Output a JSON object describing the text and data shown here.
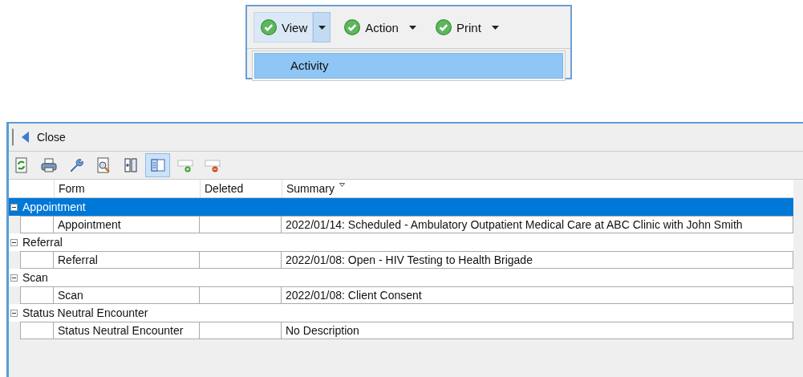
{
  "menu_bar": {
    "buttons": [
      {
        "label": "View",
        "selected": true
      },
      {
        "label": "Action",
        "selected": false
      },
      {
        "label": "Print",
        "selected": false
      }
    ],
    "dropdown": [
      {
        "label": "Activity",
        "selected": true
      }
    ]
  },
  "window": {
    "close_label": "Close",
    "toolbar": [
      {
        "kind": "refresh",
        "pressed": false
      },
      {
        "kind": "print",
        "pressed": false
      },
      {
        "kind": "wrench",
        "pressed": false
      },
      {
        "kind": "preview",
        "pressed": false
      },
      {
        "kind": "columns",
        "pressed": false
      },
      {
        "kind": "layout",
        "pressed": true
      },
      {
        "kind": "add",
        "pressed": false
      },
      {
        "kind": "remove",
        "pressed": false
      }
    ],
    "table": {
      "columns": [
        "Form",
        "Deleted",
        "Summary"
      ],
      "groups": [
        {
          "label": "Appointment",
          "expanded": true,
          "selected": true,
          "rows": [
            {
              "form": "Appointment",
              "deleted": "",
              "summary": "2022/01/14: Scheduled - Ambulatory Outpatient Medical Care at ABC Clinic with John Smith"
            }
          ]
        },
        {
          "label": "Referral",
          "expanded": true,
          "selected": false,
          "rows": [
            {
              "form": "Referral",
              "deleted": "",
              "summary": "2022/01/08: Open - HIV Testing to Health Brigade"
            }
          ]
        },
        {
          "label": "Scan",
          "expanded": true,
          "selected": false,
          "rows": [
            {
              "form": "Scan",
              "deleted": "",
              "summary": "2022/01/08: Client Consent"
            }
          ]
        },
        {
          "label": "Status Neutral Encounter",
          "expanded": true,
          "selected": false,
          "rows": [
            {
              "form": "Status Neutral Encounter",
              "deleted": "",
              "summary": "No Description"
            }
          ]
        }
      ]
    }
  }
}
